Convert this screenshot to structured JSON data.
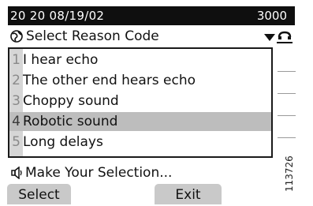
{
  "status_bar": {
    "datetime": "20 20 08/19/02",
    "extension": "3000"
  },
  "header": {
    "title": "Select Reason Code",
    "title_icon": "globe-icon",
    "dropdown_icon": "chevron-down-icon",
    "edge_icon": "handset-icon"
  },
  "menu": {
    "items": [
      {
        "number": "1",
        "label": "I hear echo"
      },
      {
        "number": "2",
        "label": "The other end hears echo"
      },
      {
        "number": "3",
        "label": "Choppy sound"
      },
      {
        "number": "4",
        "label": "Robotic sound"
      },
      {
        "number": "5",
        "label": "Long delays"
      }
    ],
    "selected_index": 3
  },
  "prompt": {
    "icon": "speaker-icon",
    "text": "Make Your Selection..."
  },
  "softkeys": {
    "select_label": "Select",
    "exit_label": "Exit"
  },
  "figure_id": "113726",
  "colors": {
    "status_bar_bg": "#0f0f0f",
    "selected_row": "#bdbdbd",
    "softkey_bg": "#c9c9c9"
  }
}
